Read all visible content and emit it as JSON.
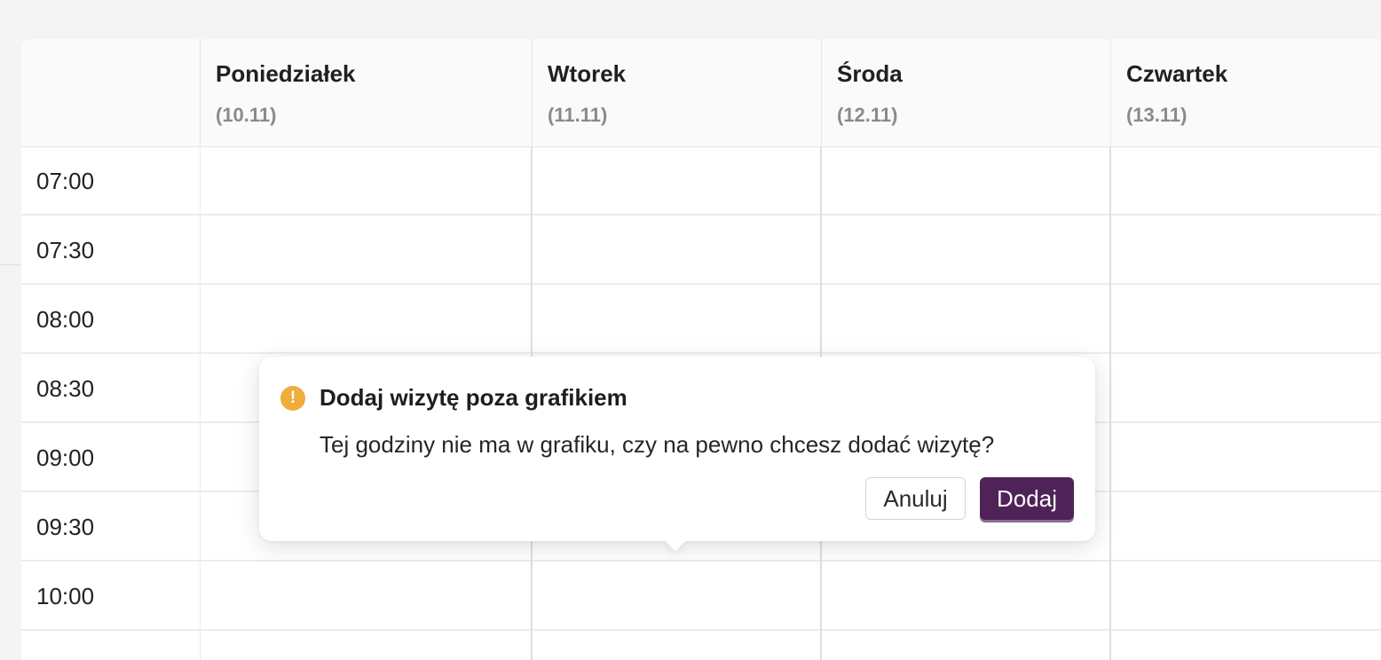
{
  "calendar": {
    "days": [
      {
        "name": "Poniedziałek",
        "date": "(10.11)"
      },
      {
        "name": "Wtorek",
        "date": "(11.11)"
      },
      {
        "name": "Środa",
        "date": "(12.11)"
      },
      {
        "name": "Czwartek",
        "date": "(13.11)"
      }
    ],
    "times": [
      "07:00",
      "07:30",
      "08:00",
      "08:30",
      "09:00",
      "09:30",
      "10:00"
    ]
  },
  "popover": {
    "icon": "warning-icon",
    "icon_glyph": "!",
    "title": "Dodaj wizytę poza grafikiem",
    "message": "Tej godziny nie ma w grafiku, czy na pewno chcesz dodać wizytę?",
    "cancel_label": "Anuluj",
    "add_label": "Dodaj"
  },
  "colors": {
    "accent": "#502358",
    "warning": "#f0ad3c"
  }
}
